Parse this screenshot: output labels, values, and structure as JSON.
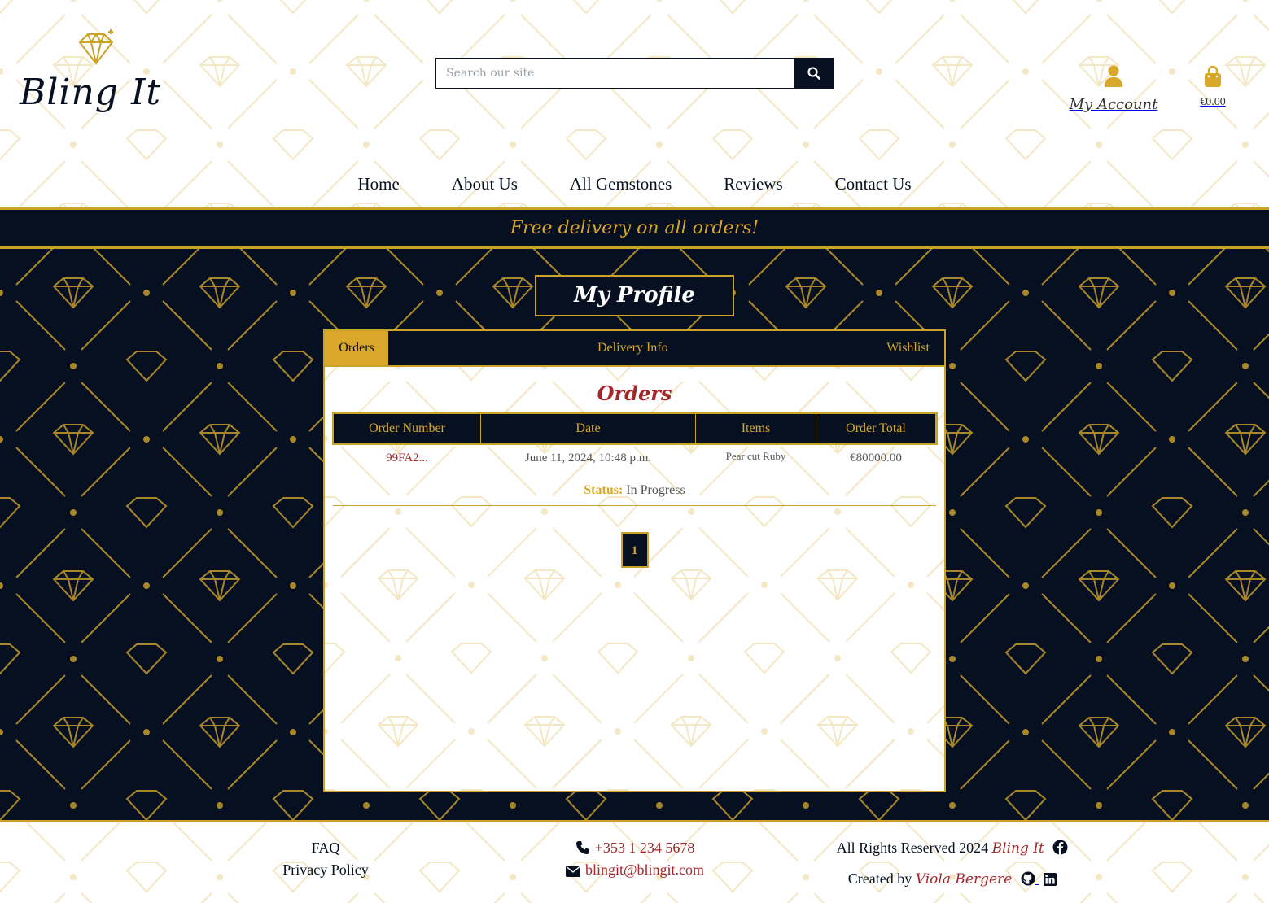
{
  "brand": {
    "name": "Bling It"
  },
  "search": {
    "placeholder": "Search our site"
  },
  "account": {
    "label": "My Account"
  },
  "cart": {
    "total": "€0.00"
  },
  "nav": {
    "items": [
      {
        "label": "Home"
      },
      {
        "label": "About Us"
      },
      {
        "label": "All Gemstones"
      },
      {
        "label": "Reviews"
      },
      {
        "label": "Contact Us"
      }
    ]
  },
  "banner": {
    "text": "Free delivery on all orders!"
  },
  "profile": {
    "title": "My Profile",
    "tabs": [
      {
        "label": "Orders",
        "active": true
      },
      {
        "label": "Delivery Info",
        "active": false
      },
      {
        "label": "Wishlist",
        "active": false
      }
    ],
    "orders": {
      "heading": "Orders",
      "columns": [
        "Order Number",
        "Date",
        "Items",
        "Order Total"
      ],
      "rows": [
        {
          "number": "99FA2...",
          "date": "June 11, 2024, 10:48 p.m.",
          "items": "Pear cut Ruby",
          "total": "€80000.00"
        }
      ],
      "status_label": "Status:",
      "status_value": "In Progress"
    },
    "pagination": {
      "current": "1"
    }
  },
  "footer": {
    "links": [
      "FAQ",
      "Privacy Policy"
    ],
    "phone": "+353 1 234 5678",
    "email": "blingit@blingit.com",
    "rights_text": "All Rights Reserved 2024",
    "rights_brand": "Bling It",
    "created_by_text": "Created by",
    "creator_name": "Viola Bergere"
  },
  "colors": {
    "navy": "#061021",
    "gold": "#d9a82a",
    "gold_border": "#c9a227",
    "ruby": "#a3262a",
    "white": "#ffffff"
  },
  "icons": {
    "search": "search-icon",
    "account": "user-icon",
    "cart": "shopping-bag-icon",
    "phone": "phone-icon",
    "email": "envelope-icon",
    "facebook": "facebook-icon",
    "github": "github-icon",
    "linkedin": "linkedin-icon",
    "logo": "diamond-logo-icon"
  }
}
